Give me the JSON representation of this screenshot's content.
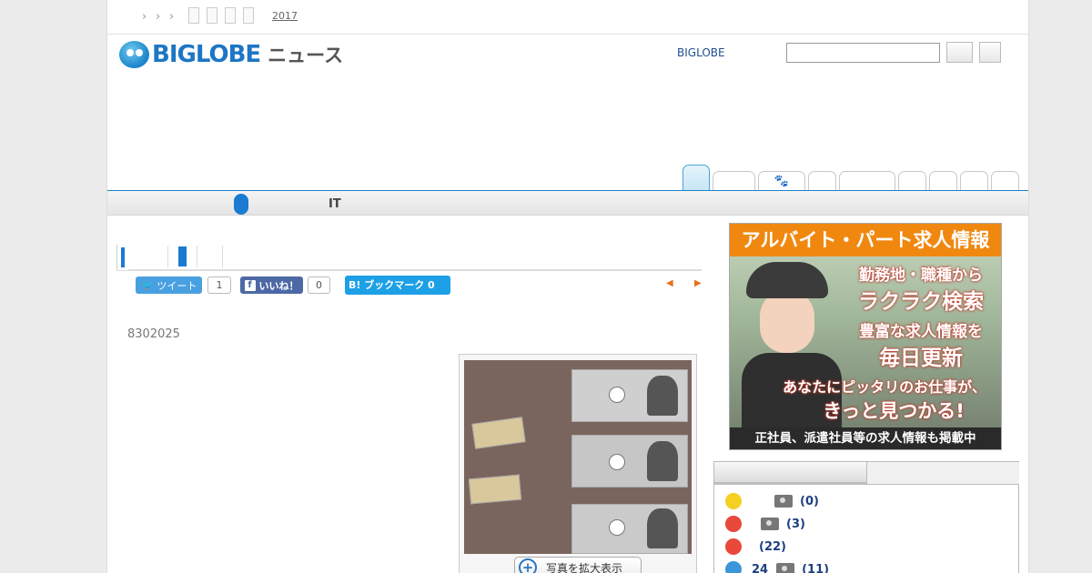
{
  "topbar": {
    "breadcrumb_separators": [
      "›",
      "›",
      "›"
    ],
    "year_link": "2017"
  },
  "header": {
    "logo_brand": "BIGLOBE",
    "logo_section": "ニュース",
    "link_label": "BIGLOBE",
    "search_placeholder": ""
  },
  "nav": {
    "tab_icon": "paw-icon"
  },
  "category_bar": {
    "it_label": "IT"
  },
  "share": {
    "tweet_label": "ツイート",
    "tweet_count": "1",
    "like_label": "いいね！",
    "like_count": "0",
    "hatena_label": "B! ブックマーク 0",
    "prev_arrow": "◀",
    "next_arrow": "▶"
  },
  "article": {
    "date": "8302025",
    "photo_zoom_label": "写真を拡大表示"
  },
  "ad": {
    "headline": "アルバイト・パート求人情報",
    "line1": "勤務地・職種から",
    "line2": "ラクラク検索",
    "line3": "豊富な求人情報を",
    "line4": "毎日更新",
    "line5": "あなたにピッタリのお仕事が、",
    "line6": "きっと見つかる!",
    "footer": "正社員、派遣社員等の求人情報も掲載中"
  },
  "ranking": {
    "rows": [
      {
        "count": "",
        "photos": "(0)",
        "mood": "neutral",
        "color": "#f5d020"
      },
      {
        "count": "",
        "photos": "(3)",
        "mood": "angry",
        "color": "#e8493a"
      },
      {
        "count": "",
        "photos": "(22)",
        "mood": "upset",
        "color": "#e8493a"
      },
      {
        "count": "24",
        "photos": "(11)",
        "mood": "sad",
        "color": "#3a96d8"
      }
    ]
  }
}
